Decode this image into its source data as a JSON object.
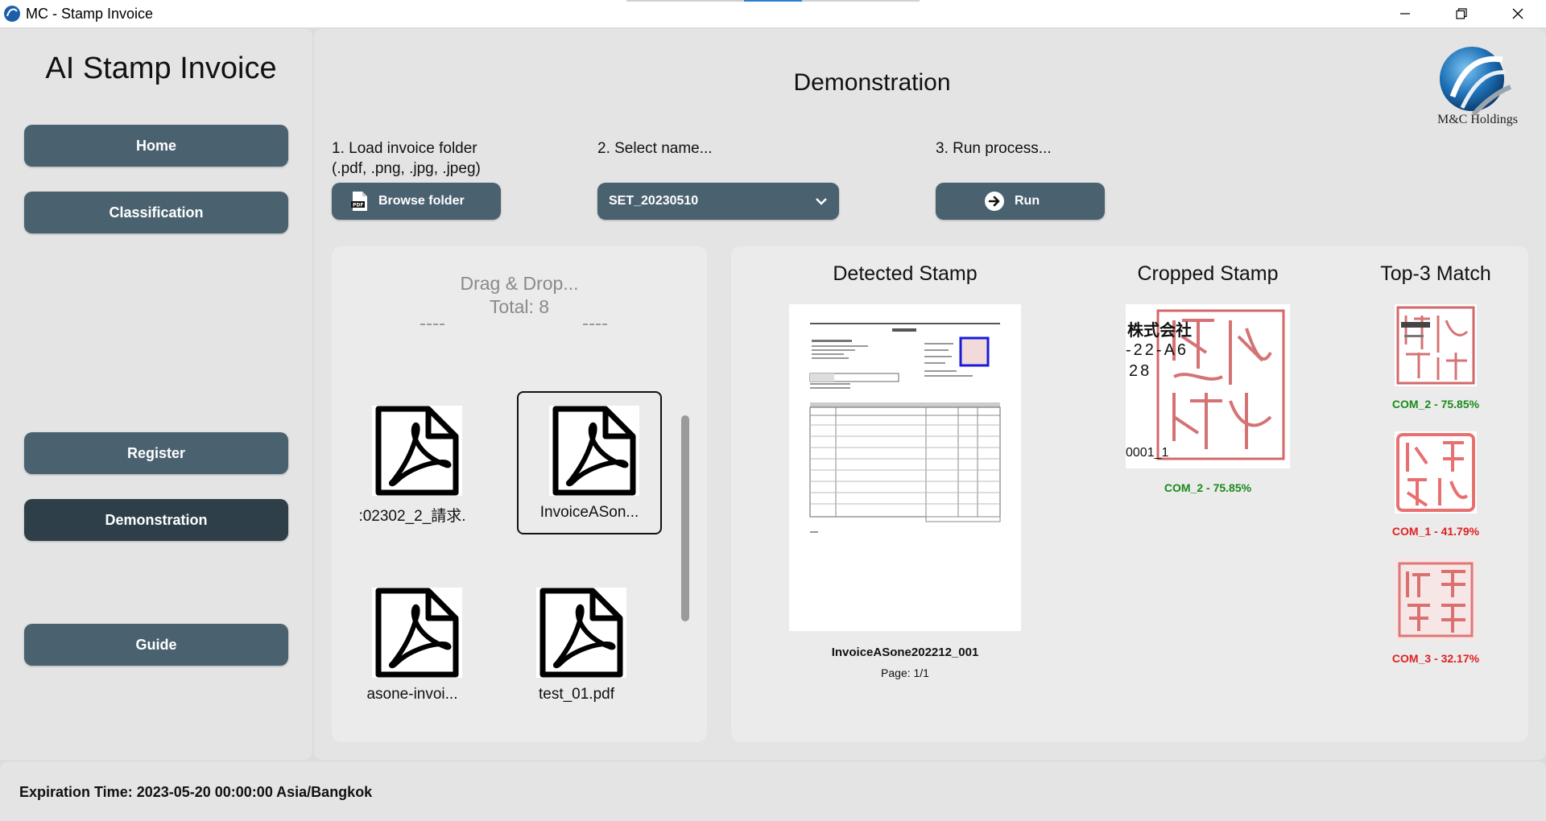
{
  "window": {
    "title": "MC - Stamp Invoice"
  },
  "sidebar": {
    "app_title": "AI Stamp Invoice",
    "items": [
      {
        "label": "Home"
      },
      {
        "label": "Classification"
      },
      {
        "label": "Register"
      },
      {
        "label": "Demonstration",
        "active": true
      },
      {
        "label": "Guide"
      }
    ]
  },
  "main": {
    "heading": "Demonstration",
    "logo_text": "M&C Holdings",
    "step1": {
      "label_line1": "1. Load invoice folder",
      "label_line2": "(.pdf, .png, .jpg, .jpeg)",
      "button": "Browse folder",
      "button_icon": "pdf-icon"
    },
    "step2": {
      "label": "2. Select name...",
      "selected": "SET_20230510"
    },
    "step3": {
      "label": "3. Run process...",
      "button": "Run",
      "button_icon": "arrow-right-circle-icon"
    }
  },
  "drop_area": {
    "title": "Drag & Drop...",
    "total": "Total: 8",
    "files": [
      {
        "name": ":02302_2_請求."
      },
      {
        "name": "InvoiceASon...",
        "selected": true
      },
      {
        "name": "asone-invoi..."
      },
      {
        "name": "test_01.pdf"
      }
    ]
  },
  "results": {
    "detected_title": "Detected Stamp",
    "cropped_title": "Cropped Stamp",
    "top3_title": "Top-3 Match",
    "invoice_name": "InvoiceASone202212_001",
    "invoice_page": "Page: 1/1",
    "cropped_score": "COM_2 - 75.85%",
    "matches": [
      {
        "label": "COM_2 - 75.85%",
        "status": "good"
      },
      {
        "label": "COM_1 - 41.79%",
        "status": "bad"
      },
      {
        "label": "COM_3 - 32.17%",
        "status": "bad"
      }
    ],
    "crop_text": {
      "line1": "株式会社",
      "line2": "-22-A6",
      "line3": "28",
      "line4": "0001_1"
    }
  },
  "status": {
    "expiration": "Expiration Time: 2023-05-20 00:00:00 Asia/Bangkok"
  },
  "colors": {
    "button": "#4a6270",
    "button_active": "#2e3f4a",
    "good": "#1a8a1a",
    "bad": "#e02020",
    "stamp_red": "#c0282a"
  }
}
